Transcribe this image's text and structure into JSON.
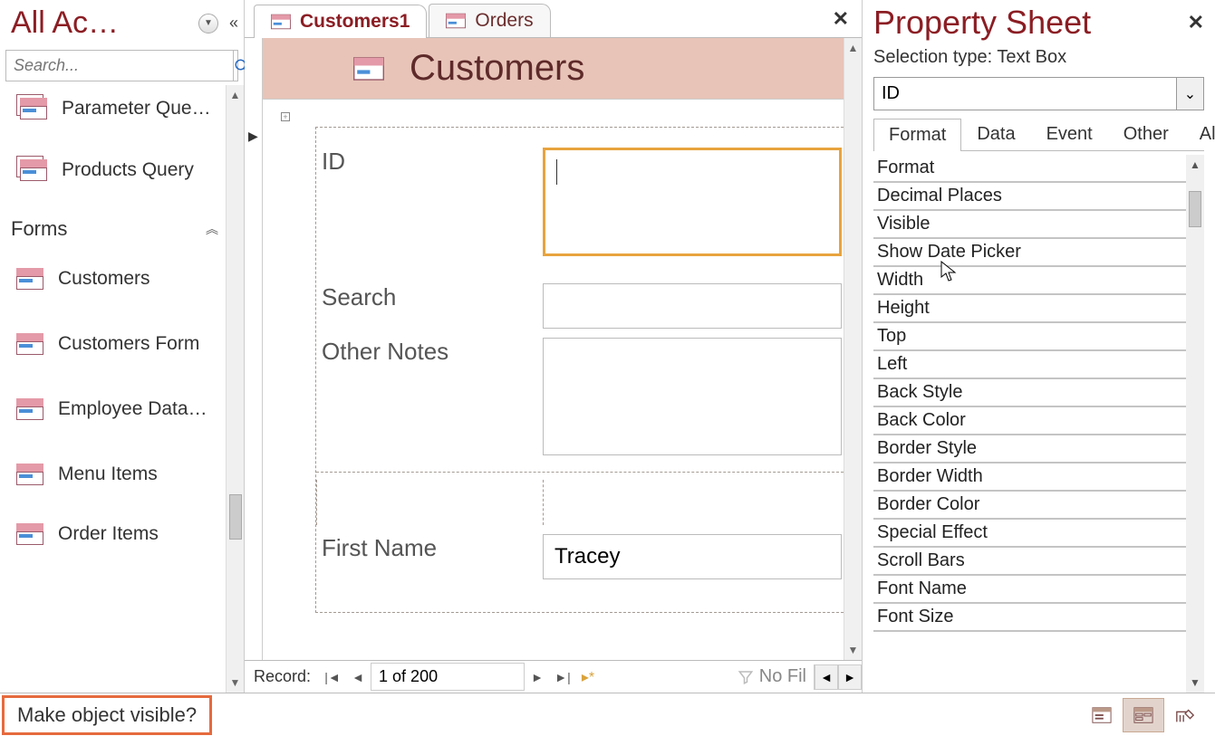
{
  "nav": {
    "title": "All Ac…",
    "search_placeholder": "Search...",
    "queries": [
      "Parameter Que…",
      "Products Query"
    ],
    "forms_header": "Forms",
    "forms": [
      "Customers",
      "Customers Form",
      "Employee Data…",
      "Menu Items",
      "Order Items"
    ]
  },
  "tabs": [
    {
      "label": "Customers1",
      "active": true
    },
    {
      "label": "Orders",
      "active": false
    }
  ],
  "form": {
    "header_title": "Customers",
    "fields": {
      "id_label": "ID",
      "search_label": "Search",
      "notes_label": "Other Notes",
      "first_name_label": "First Name",
      "first_name_value": "Tracey"
    }
  },
  "record_nav": {
    "label": "Record:",
    "position": "1 of 200",
    "filter_text": "No Fil"
  },
  "property_sheet": {
    "title": "Property Sheet",
    "selection_type_label": "Selection type: Text Box",
    "selected_object": "ID",
    "tabs": [
      "Format",
      "Data",
      "Event",
      "Other",
      "All"
    ],
    "active_tab": "Format",
    "properties": [
      "Format",
      "Decimal Places",
      "Visible",
      "Show Date Picker",
      "Width",
      "Height",
      "Top",
      "Left",
      "Back Style",
      "Back Color",
      "Border Style",
      "Border Width",
      "Border Color",
      "Special Effect",
      "Scroll Bars",
      "Font Name",
      "Font Size"
    ]
  },
  "status_bar": {
    "message": "Make object visible?"
  }
}
